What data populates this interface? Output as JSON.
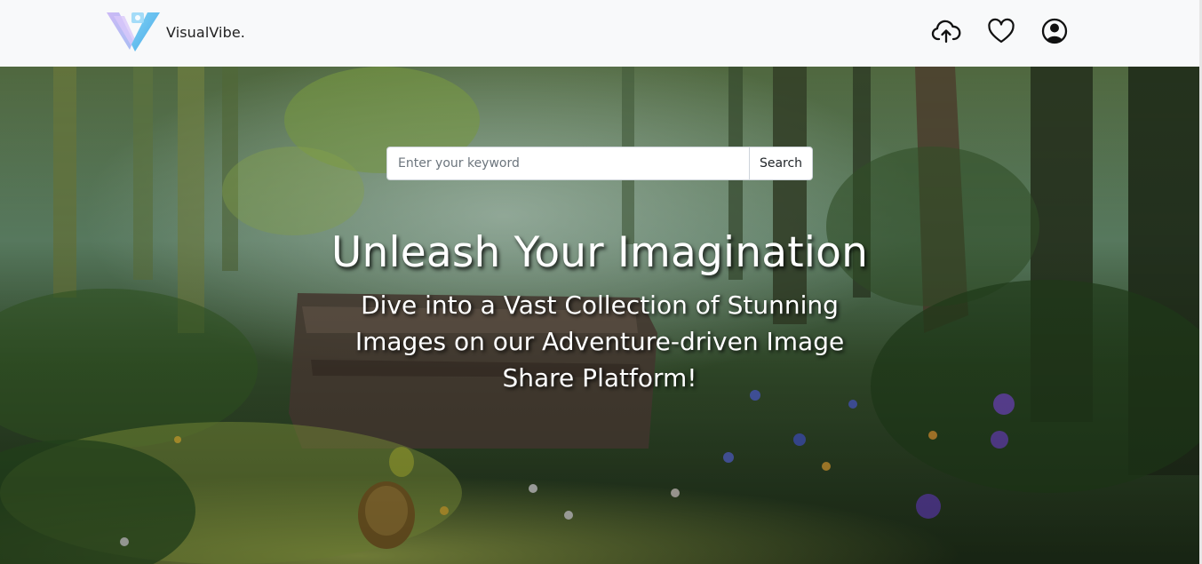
{
  "navbar": {
    "brand_text": "VisualVibe.",
    "icons": {
      "upload": "cloud-upload-icon",
      "favorites": "heart-icon",
      "account": "user-circle-icon"
    }
  },
  "search": {
    "placeholder": "Enter your keyword",
    "value": "",
    "button_label": "Search"
  },
  "hero": {
    "title": "Unleash Your Imagination",
    "subtitle": "Dive into a Vast Collection of Stunning Images on our Adventure-driven Image Share Platform!"
  },
  "colors": {
    "navbar_bg": "#f8f9fa",
    "logo_gradient_start": "#b79cf0",
    "logo_gradient_end": "#5fc3f2",
    "hero_text": "#ffffff"
  }
}
